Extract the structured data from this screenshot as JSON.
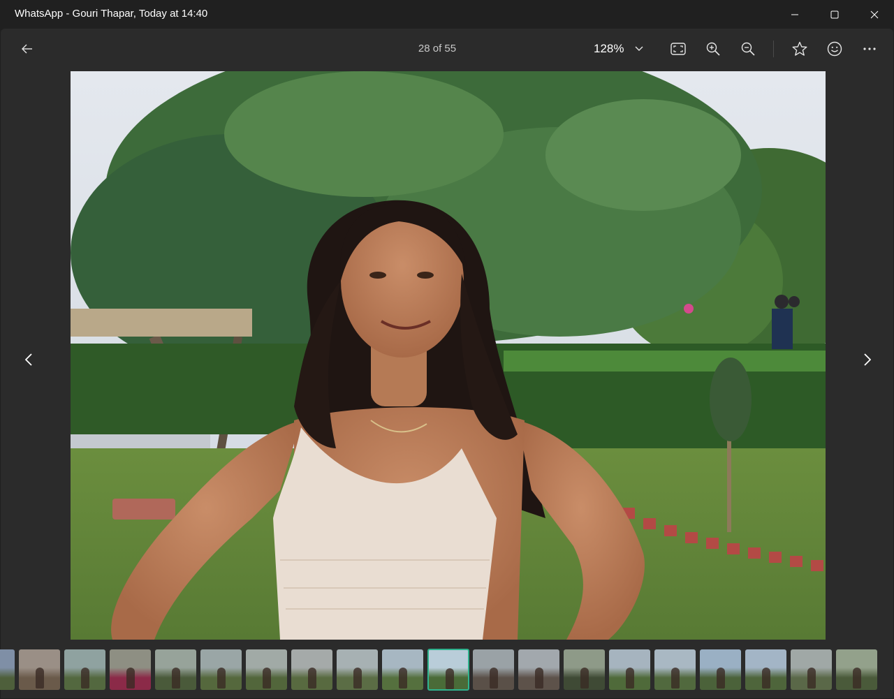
{
  "window": {
    "title": "WhatsApp - Gouri Thapar, Today at 14:40",
    "controls": [
      "minimize-icon",
      "maximize-icon",
      "close-icon"
    ]
  },
  "toolbar": {
    "back_icon": "arrow-left-icon",
    "counter": "28 of 55",
    "zoom_label": "128%",
    "zoom_dropdown_icon": "chevron-down-icon",
    "buttons": [
      "fit-to-window-icon",
      "zoom-in-icon",
      "zoom-out-icon",
      "star-icon",
      "smiley-icon",
      "more-icon"
    ]
  },
  "photo": {
    "description_icon": "photo-image"
  },
  "nav": {
    "prev_icon": "chevron-left-icon",
    "next_icon": "chevron-right-icon"
  },
  "filmstrip": {
    "selected_index": 10,
    "thumbs": [
      {
        "sky": "#7f8fa6",
        "ground": "#4e5f3b"
      },
      {
        "sky": "#9a8f86",
        "ground": "#6a5a4a"
      },
      {
        "sky": "#8fa2a0",
        "ground": "#53683f"
      },
      {
        "sky": "#8e8f83",
        "ground": "#8b2a48"
      },
      {
        "sky": "#97a39a",
        "ground": "#4a5a3a"
      },
      {
        "sky": "#9aa6a6",
        "ground": "#55683d"
      },
      {
        "sky": "#a1aaa6",
        "ground": "#52663b"
      },
      {
        "sky": "#a5aaa9",
        "ground": "#586a40"
      },
      {
        "sky": "#a7b1b3",
        "ground": "#5b6d45"
      },
      {
        "sky": "#a7b7c2",
        "ground": "#55703e"
      },
      {
        "sky": "#b9cdd9",
        "ground": "#4a6b38"
      },
      {
        "sky": "#9aa2a6",
        "ground": "#5a5048"
      },
      {
        "sky": "#a2a8ad",
        "ground": "#5d524a"
      },
      {
        "sky": "#8e9a88",
        "ground": "#3f4a35"
      },
      {
        "sky": "#a6b4bf",
        "ground": "#4f6a3a"
      },
      {
        "sky": "#a9b8c3",
        "ground": "#51693e"
      },
      {
        "sky": "#9ab0c4",
        "ground": "#4b623a"
      },
      {
        "sky": "#a3b5c6",
        "ground": "#4e653b"
      },
      {
        "sky": "#a0a8a6",
        "ground": "#5a6848"
      },
      {
        "sky": "#93a18b",
        "ground": "#4a5a3a"
      }
    ]
  },
  "colors": {
    "accent": "#2fb38e",
    "background": "#202020",
    "viewer": "#2b2b2b"
  }
}
